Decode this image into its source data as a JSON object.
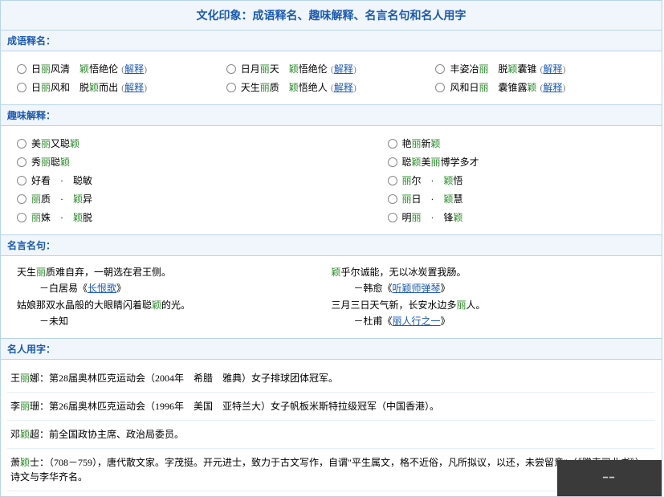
{
  "title": "文化印象：成语释名、趣味解释、名言名句和名人用字",
  "sections": {
    "idiom": {
      "header": "成语释名：",
      "explain_label": "解释",
      "rows": [
        [
          {
            "p1": "日",
            "h1": "丽",
            "p2": "风清　",
            "h2": "颖",
            "p3": "悟绝伦"
          },
          {
            "p1": "日月",
            "h1": "丽",
            "p2": "天　",
            "h2": "颖",
            "p3": "悟绝伦"
          },
          {
            "p1": "丰姿冶",
            "h1": "丽",
            "p2": "　脱",
            "h2": "颖",
            "p3": "囊锥"
          }
        ],
        [
          {
            "p1": "日",
            "h1": "丽",
            "p2": "风和　脱",
            "h2": "颖",
            "p3": "而出"
          },
          {
            "p1": "天生",
            "h1": "丽",
            "p2": "质　",
            "h2": "颖",
            "p3": "悟绝人"
          },
          {
            "p1": "风和日",
            "h1": "丽",
            "p2": "　囊锥露",
            "h2": "颖",
            "p3": ""
          }
        ]
      ]
    },
    "fun": {
      "header": "趣味解释：",
      "left": [
        {
          "pre": "美",
          "h1": "丽",
          "mid": "又聪",
          "h2": "颖",
          "post": ""
        },
        {
          "pre": "秀",
          "h1": "丽",
          "mid": "聪",
          "h2": "颖",
          "post": ""
        },
        {
          "pre": "好看　·　聪敏",
          "h1": "",
          "mid": "",
          "h2": "",
          "post": ""
        },
        {
          "pre": "",
          "h1": "丽",
          "mid": "质　·　",
          "h2": "颖",
          "post": "异"
        },
        {
          "pre": "",
          "h1": "丽",
          "mid": "姝　·　",
          "h2": "颖",
          "post": "脱"
        }
      ],
      "right": [
        {
          "pre": "艳",
          "h1": "丽",
          "mid": "新",
          "h2": "颖",
          "post": ""
        },
        {
          "pre": "聪",
          "h1": "颖",
          "mid": "美",
          "h2": "丽",
          "post": "博学多才"
        },
        {
          "pre": "",
          "h1": "丽",
          "mid": "尔　·　",
          "h2": "颖",
          "post": "悟"
        },
        {
          "pre": "",
          "h1": "丽",
          "mid": "日　·　",
          "h2": "颖",
          "post": "慧"
        },
        {
          "pre": "明",
          "h1": "丽",
          "mid": "　·　锋",
          "h2": "颖",
          "post": ""
        }
      ]
    },
    "quotes": {
      "header": "名言名句：",
      "left": [
        {
          "text_pre": "天生",
          "h": "丽",
          "text_post": "质难自弃，一朝选在君王侧。",
          "src_pre": "－白居易《",
          "link": "长恨歌",
          "src_post": "》"
        },
        {
          "text_pre": "姑娘那双水晶般的大眼睛闪着聪",
          "h": "颖",
          "text_post": "的光。",
          "src_pre": "－未知",
          "link": "",
          "src_post": ""
        }
      ],
      "right": [
        {
          "text_pre": "",
          "h": "颖",
          "text_post": "乎尔诚能，无以冰炭置我肠。",
          "src_pre": "－韩愈《",
          "link": "听颖师弹琴",
          "src_post": "》"
        },
        {
          "text_pre": "三月三日天气新，长安水边多",
          "h": "丽",
          "text_post": "人。",
          "src_pre": "－杜甫《",
          "link": "丽人行之一",
          "src_post": "》"
        }
      ]
    },
    "people": {
      "header": "名人用字：",
      "items": [
        {
          "name_pre": "王",
          "h": "丽",
          "name_post": "娜",
          "desc": "：第28届奥林匹克运动会（2004年　希腊　雅典）女子排球团体冠军。"
        },
        {
          "name_pre": "李",
          "h": "丽",
          "name_post": "珊",
          "desc": "：第26届奥林匹克运动会（1996年　美国　亚特兰大）女子帆板米斯特拉级冠军（中国香港）。"
        },
        {
          "name_pre": "邓",
          "h": "颖",
          "name_post": "超",
          "desc": "：前全国政协主席、政治局委员。"
        },
        {
          "name_pre": "萧",
          "h": "颖",
          "name_post": "士",
          "desc": "：（708－759），唐代散文家。字茂挺。开元进士，致力于古文写作，自谓\"平生属文，格不近俗，凡所拟议，以还，未尝留意\"（《赠韦司业书》）。诗文与李华齐名。"
        }
      ]
    }
  }
}
